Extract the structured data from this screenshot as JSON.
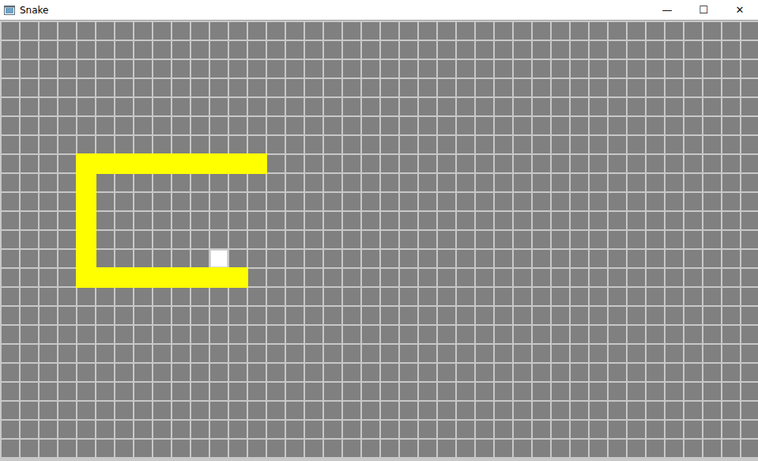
{
  "window": {
    "title": "Snake",
    "controls": [
      "—",
      "☐",
      "✕"
    ]
  },
  "grid": {
    "columns": 40,
    "rows": 23
  },
  "snake": {
    "cells": [
      [
        13,
        7
      ],
      [
        12,
        7
      ],
      [
        11,
        7
      ],
      [
        10,
        7
      ],
      [
        9,
        7
      ],
      [
        8,
        7
      ],
      [
        7,
        7
      ],
      [
        6,
        7
      ],
      [
        5,
        7
      ],
      [
        4,
        7
      ],
      [
        4,
        8
      ],
      [
        4,
        9
      ],
      [
        4,
        10
      ],
      [
        4,
        11
      ],
      [
        4,
        12
      ],
      [
        4,
        13
      ],
      [
        5,
        13
      ],
      [
        6,
        13
      ],
      [
        7,
        13
      ],
      [
        8,
        13
      ],
      [
        9,
        13
      ],
      [
        10,
        13
      ],
      [
        11,
        13
      ],
      [
        12,
        13
      ]
    ]
  },
  "food": {
    "col": 11,
    "row": 12
  }
}
